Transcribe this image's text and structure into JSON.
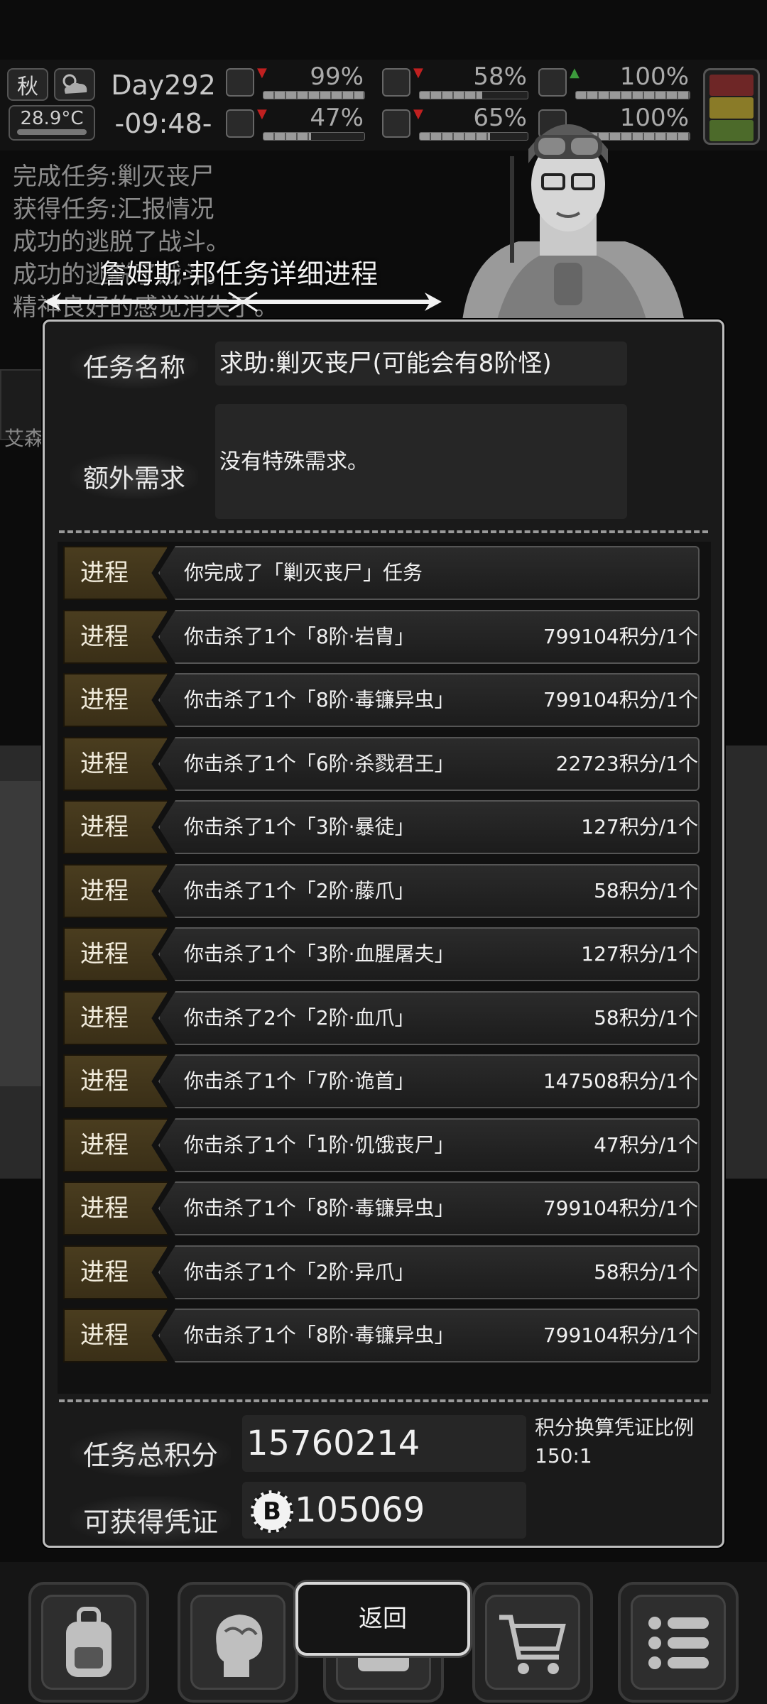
{
  "hud": {
    "season": "秋",
    "temperature": "28.9°C",
    "day": "Day292",
    "time": "-09:48-",
    "stats": [
      {
        "icon": "medkit-icon",
        "value": "99%",
        "fill": 0.99,
        "trend": "down"
      },
      {
        "icon": "stomach-icon",
        "value": "58%",
        "fill": 0.58,
        "trend": "down"
      },
      {
        "icon": "energy-icon",
        "value": "100%",
        "fill": 1.0,
        "trend": "up"
      },
      {
        "icon": "boot-icon",
        "value": "47%",
        "fill": 0.47,
        "trend": "down"
      },
      {
        "icon": "water-drop-icon",
        "value": "65%",
        "fill": 0.65,
        "trend": "down"
      },
      {
        "icon": "sanity-icon",
        "value": "100%",
        "fill": 1.0,
        "trend": "none"
      }
    ],
    "alert_colors": [
      "#7a2a2a",
      "#8a7a28",
      "#4a6a2a"
    ]
  },
  "log": [
    "完成任务:剿灭丧尸",
    "获得任务:汇报情况",
    "成功的逃脱了战斗。",
    "成功的逃脱了战斗。",
    "精神良好的感觉消失了。"
  ],
  "background": {
    "side_label": "艾森"
  },
  "dialog": {
    "title": "詹姆斯·邦任务详细进程",
    "task_name_label": "任务名称",
    "task_name": "求助:剿灭丧尸(可能会有8阶怪)",
    "extra_req_label": "额外需求",
    "extra_req": "没有特殊需求。",
    "progress_tag": "进程",
    "progress": [
      {
        "desc": "你完成了「剿灭丧尸」任务",
        "score": ""
      },
      {
        "desc": "你击杀了1个「8阶·岩胄」",
        "score": "799104积分/1个"
      },
      {
        "desc": "你击杀了1个「8阶·毒镰异虫」",
        "score": "799104积分/1个"
      },
      {
        "desc": "你击杀了1个「6阶·杀戮君王」",
        "score": "22723积分/1个"
      },
      {
        "desc": "你击杀了1个「3阶·暴徒」",
        "score": "127积分/1个"
      },
      {
        "desc": "你击杀了1个「2阶·藤爪」",
        "score": "58积分/1个"
      },
      {
        "desc": "你击杀了1个「3阶·血腥屠夫」",
        "score": "127积分/1个"
      },
      {
        "desc": "你击杀了2个「2阶·血爪」",
        "score": "58积分/1个"
      },
      {
        "desc": "你击杀了1个「7阶·诡首」",
        "score": "147508积分/1个"
      },
      {
        "desc": "你击杀了1个「1阶·饥饿丧尸」",
        "score": "47积分/1个"
      },
      {
        "desc": "你击杀了1个「8阶·毒镰异虫」",
        "score": "799104积分/1个"
      },
      {
        "desc": "你击杀了1个「2阶·异爪」",
        "score": "58积分/1个"
      },
      {
        "desc": "你击杀了1个「8阶·毒镰异虫」",
        "score": "799104积分/1个"
      }
    ],
    "total_label": "任务总积分",
    "total_value": "15760214",
    "ratio_label": "积分换算凭证比例",
    "ratio_value": "150:1",
    "voucher_label": "可获得凭证",
    "voucher_value": "105069"
  },
  "nav": {
    "items": [
      "backpack-icon",
      "brain-icon",
      "radio-icon",
      "cart-icon",
      "menu-list-icon"
    ],
    "back_label": "返回"
  }
}
